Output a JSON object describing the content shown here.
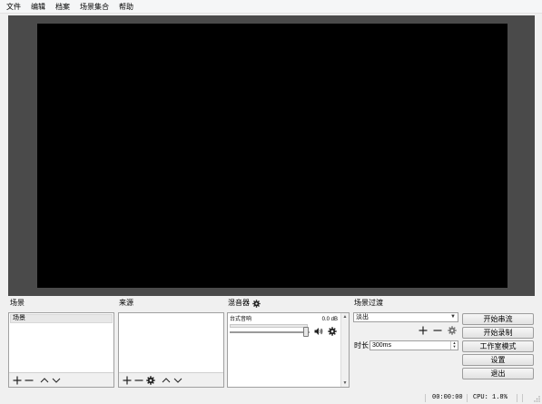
{
  "menu": {
    "items": [
      "文件",
      "编辑",
      "档案",
      "场景集合",
      "帮助"
    ]
  },
  "panels": {
    "scenes": {
      "title": "场景",
      "items": [
        "场景"
      ]
    },
    "sources": {
      "title": "来源"
    },
    "mixer": {
      "title": "混音器",
      "channel_name": "台式音响",
      "channel_db": "0.0 dB",
      "volume_fraction": 0.95
    },
    "transitions": {
      "title": "场景过渡",
      "selected": "淡出",
      "duration_label": "时长",
      "duration_value": "300ms"
    }
  },
  "controls": {
    "start_streaming": "开始串流",
    "start_recording": "开始录制",
    "studio_mode": "工作室模式",
    "settings": "设置",
    "exit": "退出"
  },
  "status": {
    "time": "00:00:00",
    "cpu": "CPU: 1.8%"
  },
  "colors": {
    "preview_bg": "#4a4a4a",
    "canvas": "#000000",
    "window_bg": "#f0f0f0"
  }
}
